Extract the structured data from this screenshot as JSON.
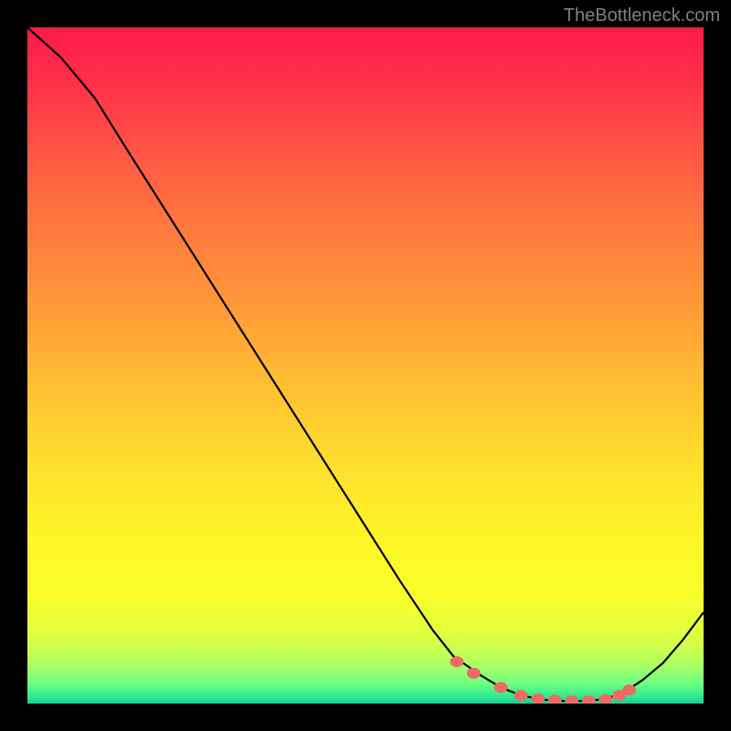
{
  "attribution": "TheBottleneck.com",
  "chart_data": {
    "type": "line",
    "title": "",
    "xlabel": "",
    "ylabel": "",
    "x": [
      0,
      0.05,
      0.1,
      0.15,
      0.2,
      0.25,
      0.3,
      0.35,
      0.4,
      0.45,
      0.5,
      0.55,
      0.6,
      0.63,
      0.67,
      0.7,
      0.73,
      0.76,
      0.79,
      0.82,
      0.85,
      0.88,
      0.91,
      0.94,
      0.97,
      1.0
    ],
    "values": [
      1.0,
      0.955,
      0.895,
      0.815,
      0.736,
      0.657,
      0.578,
      0.499,
      0.42,
      0.341,
      0.262,
      0.183,
      0.108,
      0.07,
      0.042,
      0.024,
      0.012,
      0.006,
      0.004,
      0.004,
      0.006,
      0.015,
      0.035,
      0.06,
      0.095,
      0.135
    ],
    "markers_x": [
      0.635,
      0.66,
      0.7,
      0.73,
      0.755,
      0.78,
      0.805,
      0.83,
      0.855,
      0.875,
      0.89
    ],
    "markers_y": [
      0.062,
      0.045,
      0.024,
      0.012,
      0.007,
      0.005,
      0.004,
      0.004,
      0.006,
      0.012,
      0.02
    ],
    "xlim": [
      0,
      1
    ],
    "ylim": [
      0,
      1
    ]
  },
  "colors": {
    "marker": "#ec6c63",
    "curve": "#000000",
    "frame": "#000000"
  }
}
